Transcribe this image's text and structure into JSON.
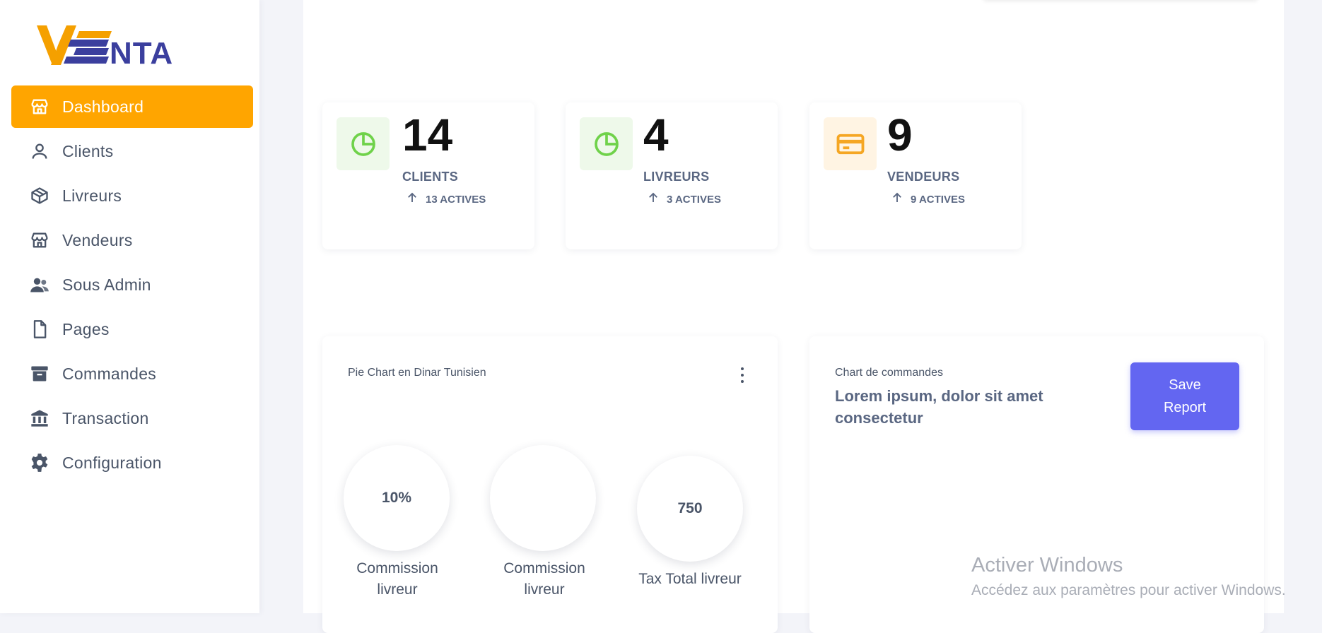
{
  "brand": {
    "logo_text": "VENTA",
    "accent": "#ffa500",
    "secondary": "#3b3f9e"
  },
  "sidebar": {
    "items": [
      {
        "label": "Dashboard",
        "icon": "store-icon",
        "active": true
      },
      {
        "label": "Clients",
        "icon": "user-icon"
      },
      {
        "label": "Livreurs",
        "icon": "package-icon"
      },
      {
        "label": "Vendeurs",
        "icon": "store-icon"
      },
      {
        "label": "Sous Admin",
        "icon": "users-icon"
      },
      {
        "label": "Pages",
        "icon": "file-icon"
      },
      {
        "label": "Commandes",
        "icon": "archive-icon"
      },
      {
        "label": "Transaction",
        "icon": "bank-icon"
      },
      {
        "label": "Configuration",
        "icon": "gear-icon"
      }
    ]
  },
  "stats": [
    {
      "value": "14",
      "label": "CLIENTS",
      "sub": "13 ACTIVES",
      "icon": "pie-chart-icon",
      "color": "#6fd24a",
      "bg": "#eef9ea"
    },
    {
      "value": "4",
      "label": "LIVREURS",
      "sub": "3 ACTIVES",
      "icon": "pie-chart-icon",
      "color": "#6fd24a",
      "bg": "#eef9ea"
    },
    {
      "value": "9",
      "label": "VENDEURS",
      "sub": "9 ACTIVES",
      "icon": "credit-card-icon",
      "color": "#f5a623",
      "bg": "#fff4e3"
    }
  ],
  "pie_panel": {
    "title": "Pie Chart en Dinar Tunisien",
    "items": [
      {
        "value": "10%",
        "label_line1": "Commission",
        "label_line2": "livreur"
      },
      {
        "value": "",
        "label_line1": "Commission",
        "label_line2": "livreur"
      },
      {
        "value": "750",
        "label_line1": "Tax Total livreur",
        "label_line2": ""
      }
    ]
  },
  "orders_panel": {
    "title": "Chart de commandes",
    "subtitle": "Lorem ipsum, dolor sit amet consectetur",
    "button_line1": "Save",
    "button_line2": "Report"
  },
  "watermark": {
    "title": "Activer Windows",
    "subtitle": "Accédez aux paramètres pour activer Windows."
  }
}
